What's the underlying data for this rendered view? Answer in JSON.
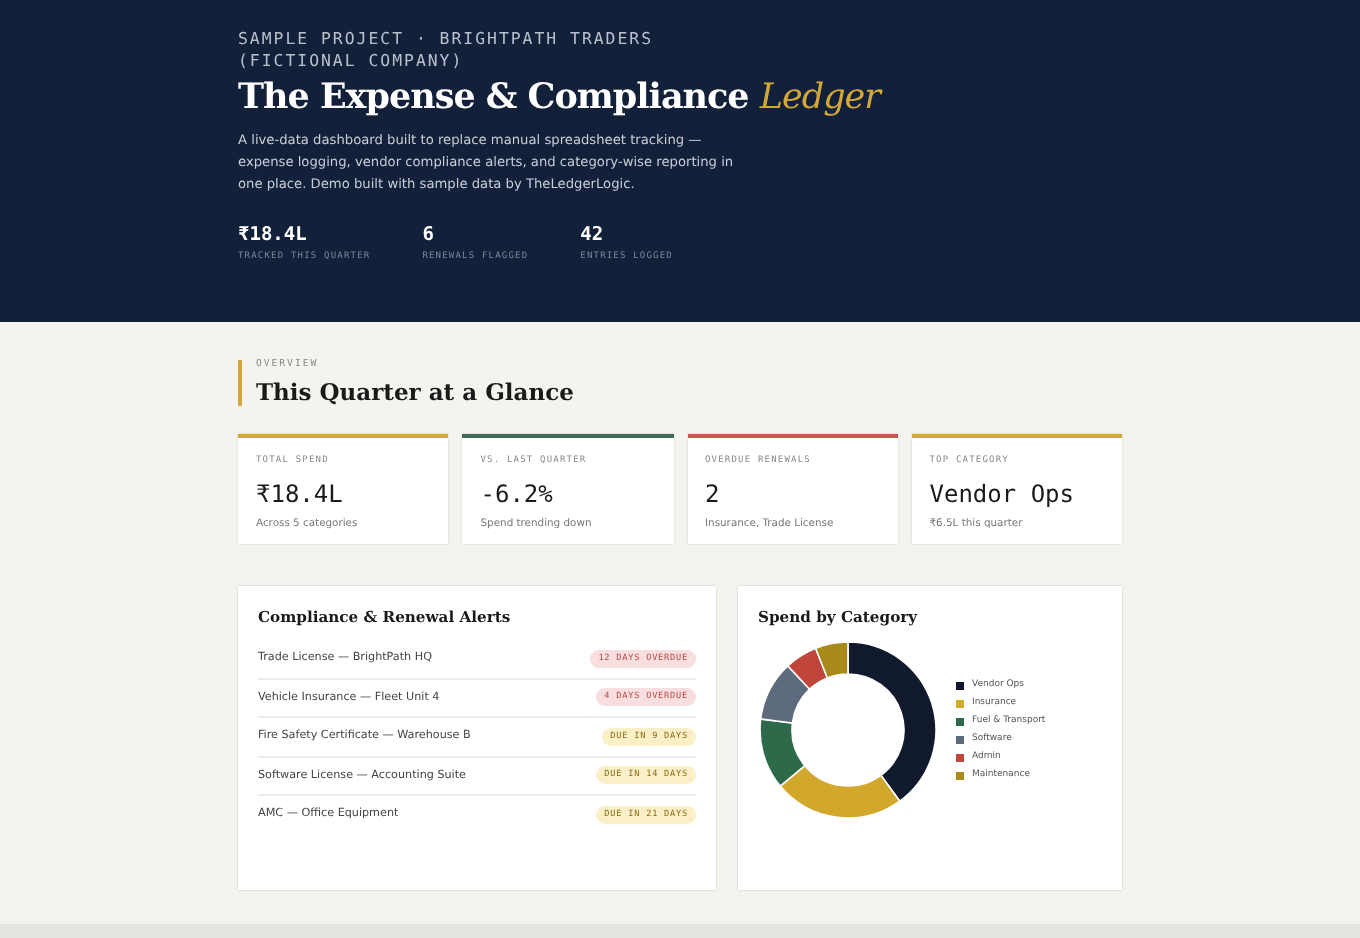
{
  "hero": {
    "eyebrow": "SAMPLE PROJECT · BRIGHTPATH TRADERS (FICTIONAL COMPANY)",
    "title": "The Expense & Compliance",
    "title_accent": "Ledger",
    "description": "A live-data dashboard built to replace manual spreadsheet tracking — expense logging, vendor compliance alerts, and category-wise reporting in one place. Demo built with sample data by TheLedgerLogic.",
    "stats": [
      {
        "value": "₹18.4L",
        "label": "TRACKED THIS QUARTER"
      },
      {
        "value": "6",
        "label": "RENEWALS FLAGGED"
      },
      {
        "value": "42",
        "label": "ENTRIES LOGGED"
      }
    ]
  },
  "overview": {
    "eyebrow": "OVERVIEW",
    "heading": "This Quarter at a Glance",
    "cards": [
      {
        "label": "TOTAL SPEND",
        "value": "₹18.4L",
        "note": "Across 5 categories",
        "color": "#d4a838"
      },
      {
        "label": "VS. LAST QUARTER",
        "value": "-6.2%",
        "note": "Spend trending down",
        "color": "#3f6b55"
      },
      {
        "label": "OVERDUE RENEWALS",
        "value": "2",
        "note": "Insurance, Trade License",
        "color": "#c8574b"
      },
      {
        "label": "TOP CATEGORY",
        "value": "Vendor Ops",
        "note": "₹6.5L this quarter",
        "color": "#d4a838"
      }
    ]
  },
  "alerts": {
    "title": "Compliance & Renewal Alerts",
    "items": [
      {
        "name": "Trade License — BrightPath HQ",
        "badge": "12 DAYS OVERDUE",
        "kind": "overdue"
      },
      {
        "name": "Vehicle Insurance — Fleet Unit 4",
        "badge": "4 DAYS OVERDUE",
        "kind": "overdue"
      },
      {
        "name": "Fire Safety Certificate — Warehouse B",
        "badge": "DUE IN 9 DAYS",
        "kind": "due"
      },
      {
        "name": "Software License — Accounting Suite",
        "badge": "DUE IN 14 DAYS",
        "kind": "due"
      },
      {
        "name": "AMC — Office Equipment",
        "badge": "DUE IN 21 DAYS",
        "kind": "due"
      }
    ]
  },
  "spend": {
    "title": "Spend by Category",
    "legend": [
      {
        "label": "Vendor Ops",
        "color": "#111a2c"
      },
      {
        "label": "Insurance",
        "color": "#d1a72c"
      },
      {
        "label": "Fuel & Transport",
        "color": "#2d6a4a"
      },
      {
        "label": "Software",
        "color": "#5e6a7d"
      },
      {
        "label": "Admin",
        "color": "#c0463c"
      },
      {
        "label": "Maintenance",
        "color": "#a88a1c"
      }
    ]
  }
}
